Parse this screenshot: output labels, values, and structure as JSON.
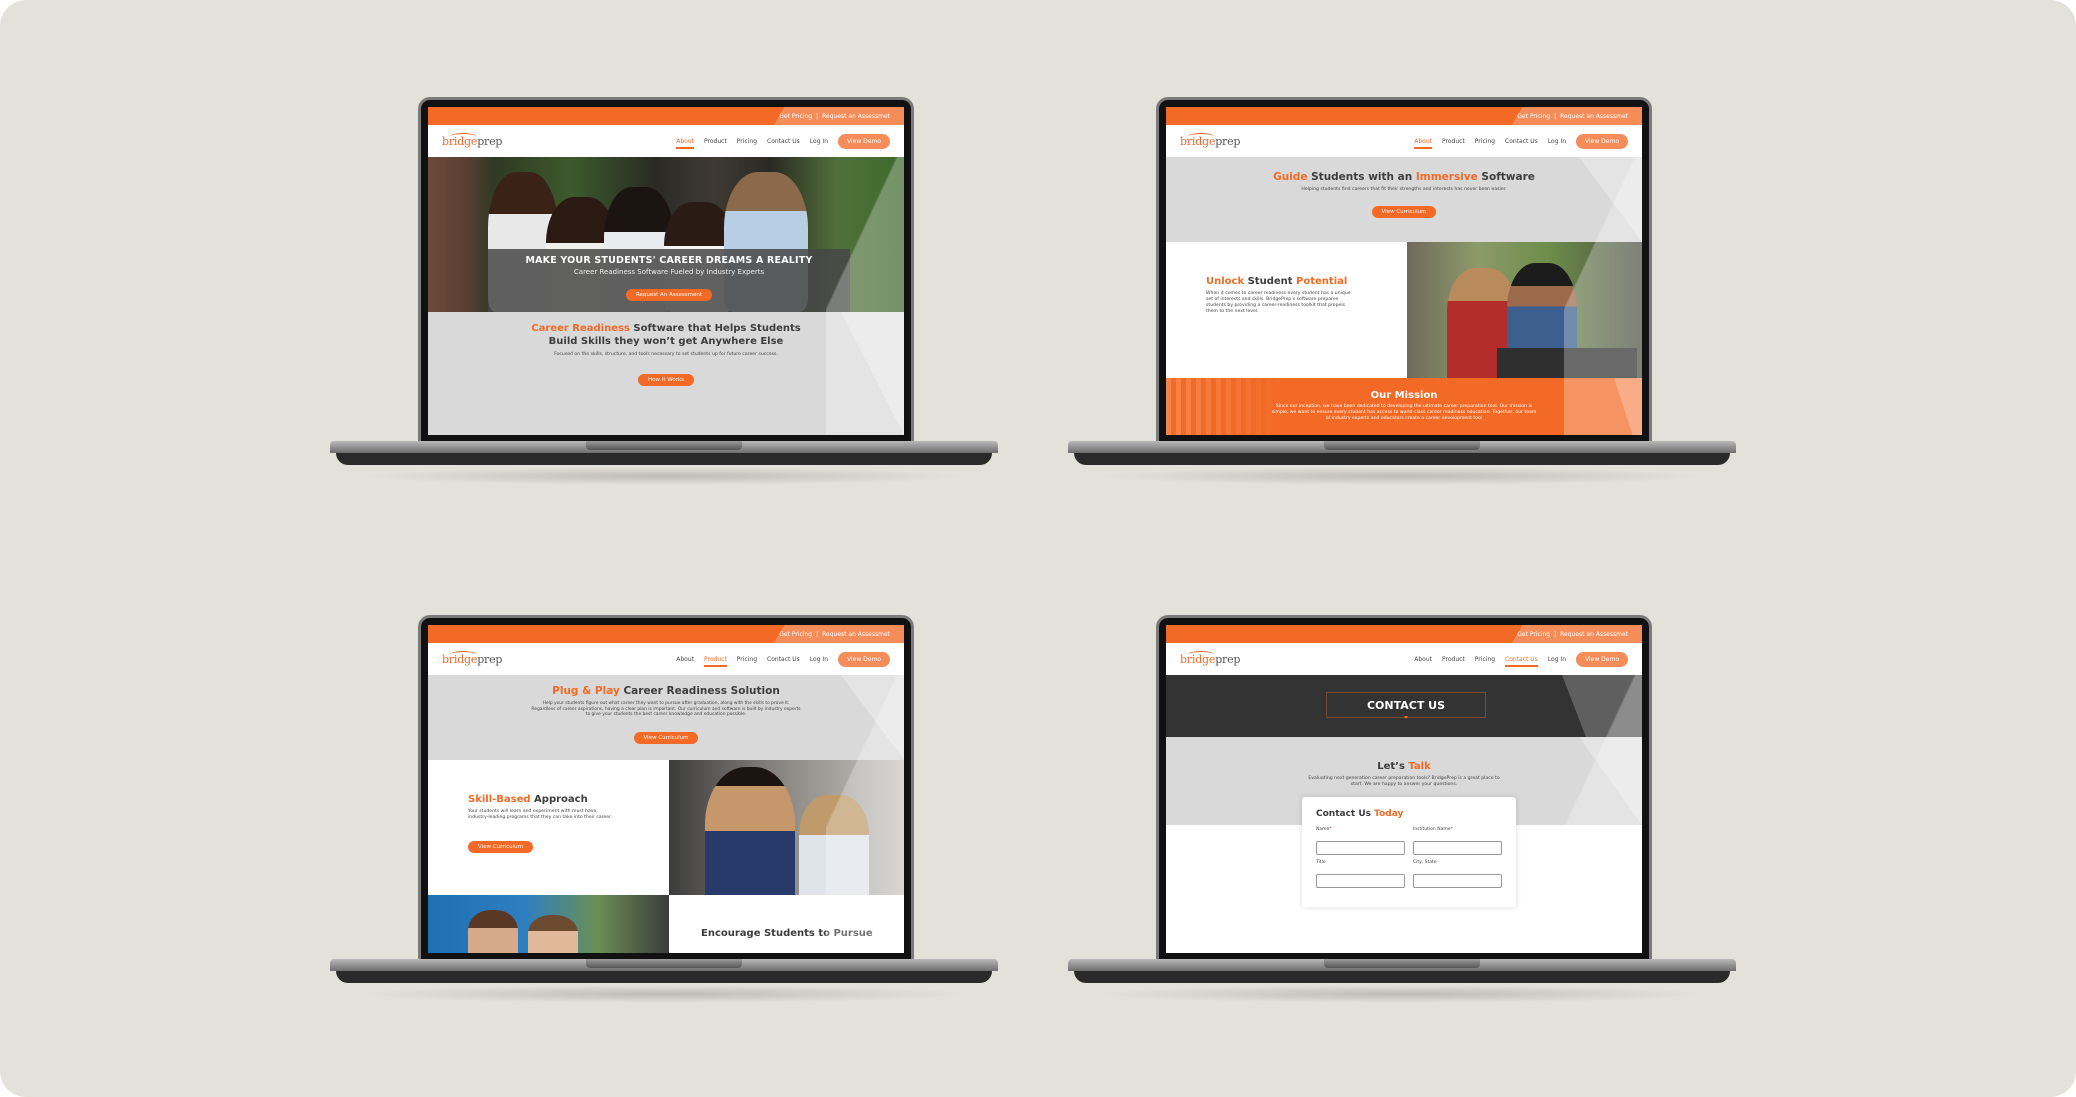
{
  "brand": {
    "name_part1": "bridge",
    "name_part2": "prep",
    "accent": "#f26a25",
    "accent_light": "#f58d5a",
    "dark": "#3d3d3d",
    "canvas_bg": "#e2e1da"
  },
  "topbar": {
    "get_pricing": "Get Pricing",
    "separator": "|",
    "request": "Request an Assessmet"
  },
  "nav": {
    "items": [
      "About",
      "Product",
      "Pricing",
      "Contact Us",
      "Log In"
    ],
    "demo": "View Demo"
  },
  "screens": [
    {
      "active_nav": "About",
      "hero": {
        "title": "MAKE YOUR STUDENTS' CAREER DREAMS A REALITY",
        "subtitle": "Career Readiness Software Fueled by Industry Experts",
        "cta": "Request An Assessment"
      },
      "section": {
        "title_accent": "Career Readiness",
        "title_rest_line1": " Software that Helps Students",
        "title_line2": "Build Skills they won’t get Anywhere Else",
        "body": "Focused on the skills, structure, and tools necessary to set students up for future career success.",
        "cta": "How It Works"
      }
    },
    {
      "active_nav": "About",
      "hero": {
        "title_w1": "Guide",
        "title_w2": " Students with an ",
        "title_w3": "Immersive",
        "title_w4": " Software",
        "subtitle": "Helping students find careers that fit their strengths and interests has never been easier.",
        "cta": "View Curriculum"
      },
      "feature": {
        "title_w1": "Unlock",
        "title_w2": " Student ",
        "title_w3": "Potential",
        "body": "When it comes to career readiness every student has a unique set of interests and skills. BridgePrep’s software prepares students by providing a career-readiness toolkit that propels them to the next level."
      },
      "mission": {
        "title": "Our Mission",
        "body": "Since our inception, we have been dedicated to developing the ultimate career preparation tool. Our mission is simple, we want to ensure every student has access to world-class career readiness education. Together, our team of industry experts and educators create a career development tool"
      }
    },
    {
      "active_nav": "Product",
      "hero": {
        "title_accent": "Plug & Play",
        "title_rest": " Career Readiness Solution",
        "body": "Help your students figure out what career they want to pursue after graduation, along with the skills to prove it. Regardless of career aspirations, having a clear plan is important. Our curriculum and software is built by industry experts to give your students the best career knowledge and education possible.",
        "cta": "View Curriculum"
      },
      "feature": {
        "title_accent": "Skill-Based",
        "title_rest": " Approach",
        "body": "Your students will learn and experiment with must have, industry-leading programs that they can take into their career.",
        "cta": "View Curriculum"
      },
      "feature2": {
        "title": "Encourage Students to Pursue"
      }
    },
    {
      "active_nav": "Contact Us",
      "hero": {
        "title": "CONTACT US"
      },
      "talk": {
        "title_dark": "Let’s ",
        "title_accent": "Talk",
        "body": "Evaluating next generation career preparation tools? BridgePrep is a great place to start. We are happy to answer your questions."
      },
      "form": {
        "title_dark": "Contact Us ",
        "title_accent": "Today",
        "fields": [
          {
            "label": "Name",
            "required": "*",
            "value": ""
          },
          {
            "label": "Institution Name",
            "required": "*",
            "value": ""
          },
          {
            "label": "Title",
            "required": "",
            "value": ""
          },
          {
            "label": "City, State",
            "required": "",
            "value": ""
          }
        ]
      }
    }
  ]
}
